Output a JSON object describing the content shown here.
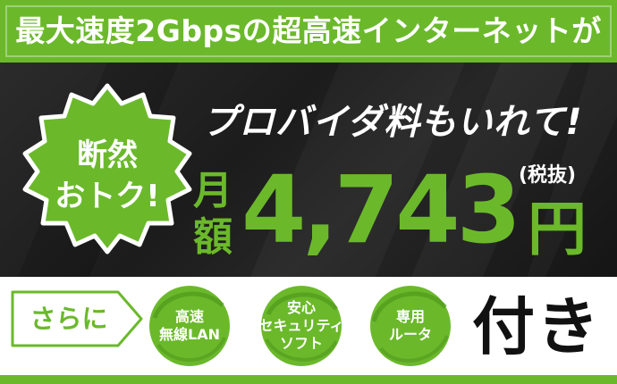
{
  "header": {
    "headline": "最大速度2Gbpsの超高速インターネットが"
  },
  "badge": {
    "line1": "断然",
    "line2": "おトク!"
  },
  "offer": {
    "provider_text": "プロバイダ料もいれて!",
    "month_label": "月額",
    "price": "4,743",
    "currency": "円",
    "tax_note": "(税抜)"
  },
  "extras": {
    "intro_label": "さらに",
    "features": [
      {
        "lines": [
          "高速",
          "無線LAN"
        ]
      },
      {
        "lines": [
          "安心",
          "セキュリティ",
          "ソフト"
        ]
      },
      {
        "lines": [
          "専用",
          "ルータ"
        ]
      }
    ],
    "included_label": "付き"
  },
  "colors": {
    "accent_green": "#6bb92b",
    "dark_background": "#1e1e1e",
    "brush_black": "#111111"
  }
}
